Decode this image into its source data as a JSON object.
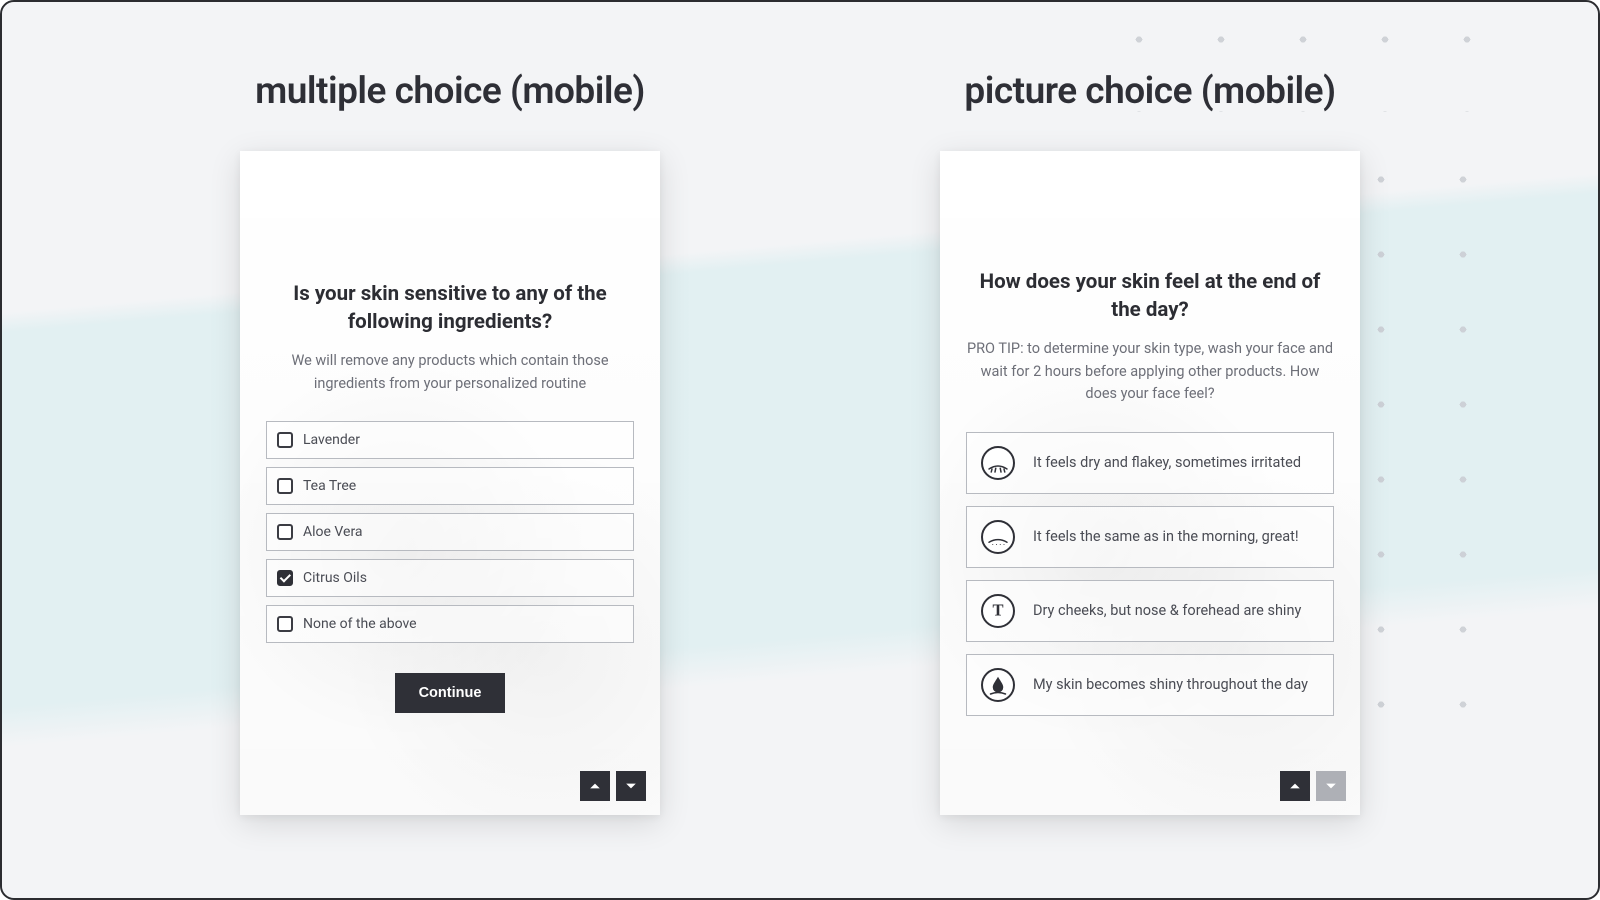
{
  "left": {
    "heading": "multiple choice (mobile)",
    "question": "Is your skin sensitive to any of the following ingredients?",
    "sub": "We will remove any products which contain those ingredients from your personalized routine",
    "options": [
      {
        "label": "Lavender",
        "checked": false
      },
      {
        "label": "Tea Tree",
        "checked": false
      },
      {
        "label": "Aloe Vera",
        "checked": false
      },
      {
        "label": "Citrus Oils",
        "checked": true
      },
      {
        "label": "None of the above",
        "checked": false
      }
    ],
    "continue_label": "Continue",
    "nav": {
      "up_enabled": true,
      "down_enabled": true
    }
  },
  "right": {
    "heading": "picture choice (mobile)",
    "question": "How does your skin feel at the end of the day?",
    "sub": "PRO TIP: to determine your skin type, wash your face and wait for 2 hours before applying other products. How does your face feel?",
    "options": [
      {
        "icon": "dry",
        "label": "It feels dry and flakey, sometimes irritated"
      },
      {
        "icon": "same",
        "label": "It feels the same as in the morning, great!"
      },
      {
        "icon": "tzone",
        "label": "Dry cheeks, but nose & forehead are shiny"
      },
      {
        "icon": "shiny",
        "label": "My skin becomes shiny throughout the day"
      }
    ],
    "nav": {
      "up_enabled": true,
      "down_enabled": false
    }
  }
}
